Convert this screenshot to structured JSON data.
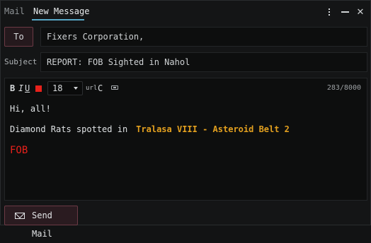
{
  "tabs": [
    {
      "label": "Mail"
    },
    {
      "label": "New Message",
      "active": true
    }
  ],
  "window_controls": {
    "icons": [
      "kebab-menu-icon",
      "minimize-icon",
      "close-icon"
    ],
    "close_glyph": "✕"
  },
  "recipient": {
    "button_label": "To",
    "value": "Fixers Corporation,"
  },
  "subject": {
    "label": "Subject",
    "value": "REPORT: FOB Sighted in Nahol"
  },
  "toolbar": {
    "bold": "B",
    "italic": "I",
    "underline": "U",
    "text_color": "#e8211b",
    "font_size": "18",
    "url": "url",
    "clear": "C",
    "char_count": "283/8000"
  },
  "body": {
    "greeting": "Hi, all!",
    "report_prefix": "Diamond Rats spotted in",
    "location_link": "Tralasa VIII - Asteroid Belt 2",
    "alert": "FOB"
  },
  "send": {
    "label": "Send Mail"
  },
  "colors": {
    "accent": "#58a8c6",
    "link": "#e3a01f",
    "alert": "#e8211b",
    "button_border": "#6b3a45"
  }
}
